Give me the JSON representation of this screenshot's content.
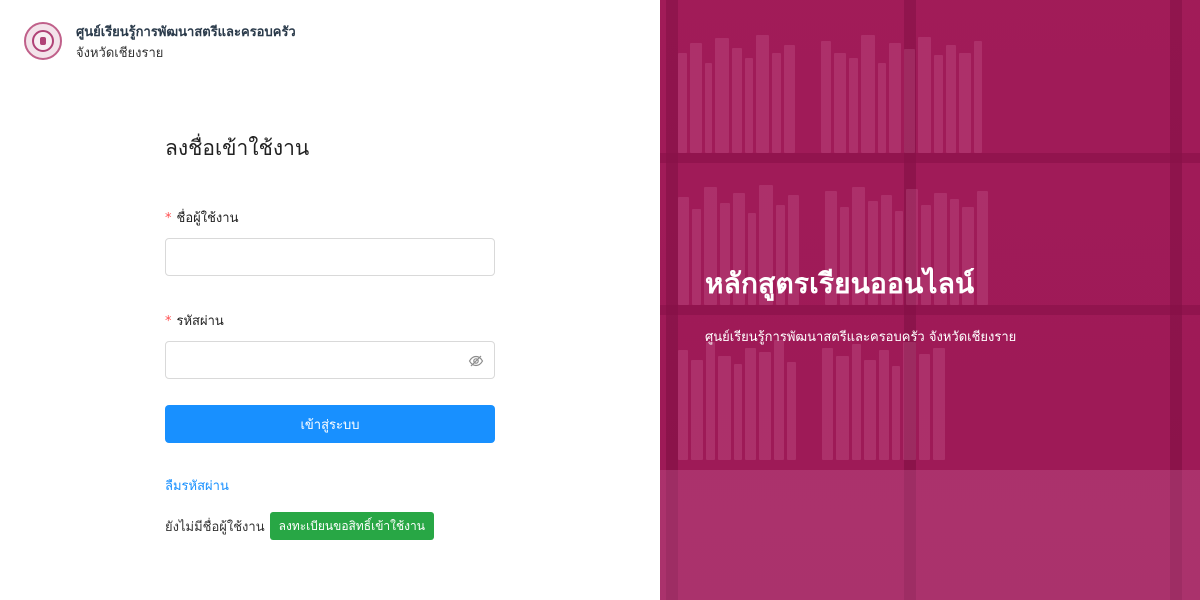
{
  "brand": {
    "org_name": "ศูนย์เรียนรู้การพัฒนาสตรีและครอบครัว",
    "province": "จังหวัดเชียงราย",
    "logo_icon": "seal-logo-icon"
  },
  "login_form": {
    "title": "ลงชื่อเข้าใช้งาน",
    "username": {
      "required_mark": "*",
      "label": "ชื่อผู้ใช้งาน",
      "value": "",
      "placeholder": ""
    },
    "password": {
      "required_mark": "*",
      "label": "รหัสผ่าน",
      "value": "",
      "placeholder": "",
      "toggle_icon": "eye-slash-icon"
    },
    "submit_label": "เข้าสู่ระบบ",
    "forgot_password_label": "ลืมรหัสผ่าน",
    "no_account_text": "ยังไม่มีชื่อผู้ใช้งาน",
    "register_label": "ลงทะเบียนขอสิทธิ์เข้าใช้งาน"
  },
  "hero": {
    "title": "หลักสูตรเรียนออนไลน์",
    "subtitle": "ศูนย์เรียนรู้การพัฒนาสตรีและครอบครัว จังหวัดเชียงราย",
    "background": "bookshelf-photo"
  },
  "colors": {
    "primary_button": "#1890ff",
    "register_button": "#28a745",
    "hero_overlay": "#9c1a55",
    "required_mark": "#ff4d4f"
  }
}
